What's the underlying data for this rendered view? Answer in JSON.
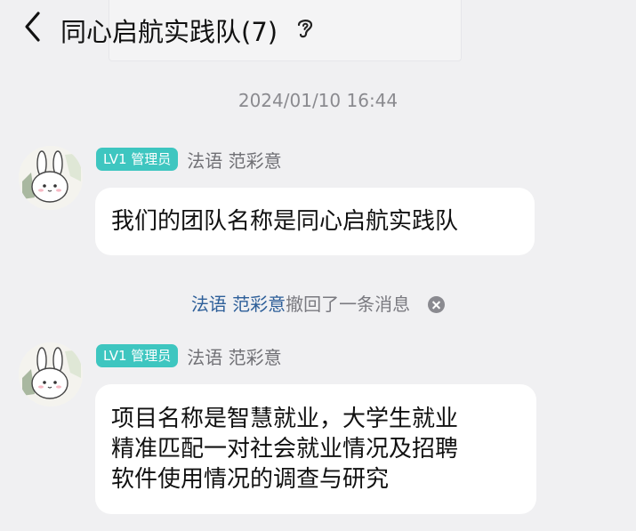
{
  "header": {
    "title": "同心启航实践队(7)",
    "back_icon": "chevron-left-icon",
    "ear_icon": "ear-icon"
  },
  "timestamp": "2024/01/10 16:44",
  "messages": [
    {
      "badge": "LV1 管理员",
      "sender": "法语 范彩意",
      "lines": [
        "我们的团队名称是同心启航实践队"
      ]
    },
    {
      "badge": "LV1 管理员",
      "sender": "法语 范彩意",
      "lines": [
        "项目名称是智慧就业，大学生就业",
        "精准匹配一对社会就业情况及招聘",
        "软件使用情况的调查与研究"
      ]
    }
  ],
  "recall": {
    "who": "法语 范彩意",
    "text": "撤回了一条消息"
  },
  "colors": {
    "background": "#f0f0f2",
    "badge": "#3ec6c0",
    "link": "#2e5f99",
    "bubble": "#ffffff"
  }
}
